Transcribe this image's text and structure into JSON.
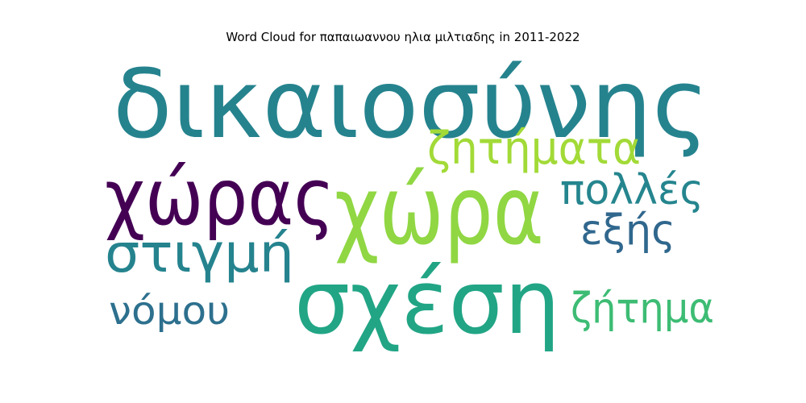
{
  "chart_data": {
    "type": "wordcloud",
    "title": "Word Cloud for παπαιωαννου ηλια μιλτιαδης in 2011-2022",
    "words": [
      {
        "text": "δικαιοσύνης",
        "weight": 100,
        "color": "#25838e"
      },
      {
        "text": "χώρα",
        "weight": 94,
        "color": "#90d743"
      },
      {
        "text": "σχέση",
        "weight": 90,
        "color": "#21a585"
      },
      {
        "text": "χώρας",
        "weight": 80,
        "color": "#440154"
      },
      {
        "text": "στιγμή",
        "weight": 52,
        "color": "#25838e"
      },
      {
        "text": "ζητήματα",
        "weight": 46,
        "color": "#a2da37"
      },
      {
        "text": "πολλές",
        "weight": 44,
        "color": "#25858e"
      },
      {
        "text": "ζήτημα",
        "weight": 44,
        "color": "#3dbc74"
      },
      {
        "text": "εξής",
        "weight": 42,
        "color": "#30678d"
      },
      {
        "text": "νόμου",
        "weight": 40,
        "color": "#2d708e"
      }
    ]
  }
}
